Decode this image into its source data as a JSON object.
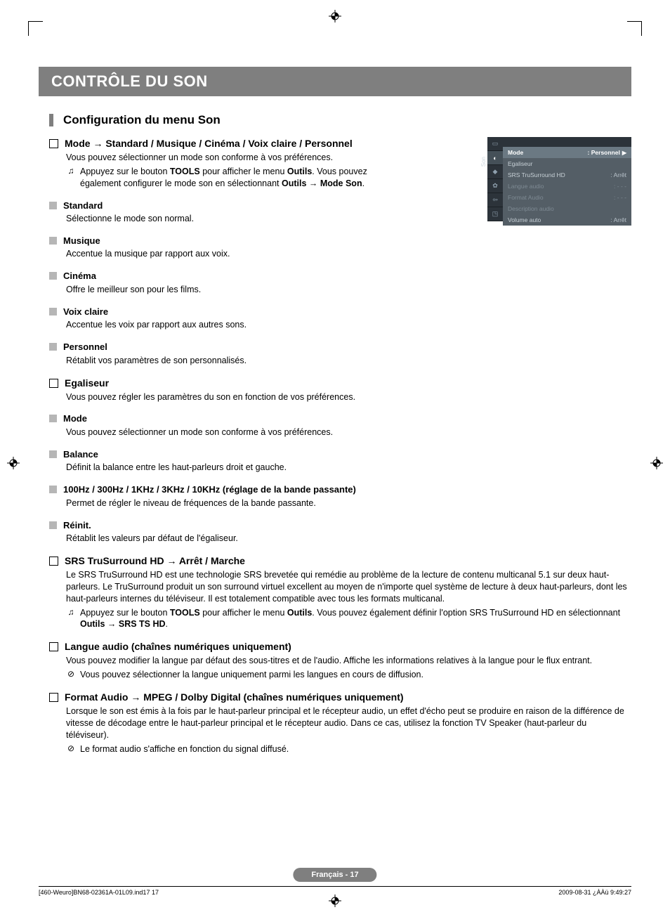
{
  "header": {
    "title": "CONTRÔLE DU SON"
  },
  "section": {
    "title": "Configuration du menu Son"
  },
  "mode_block": {
    "heading": "Mode → Standard / Musique / Cinéma / Voix claire / Personnel",
    "lead": "Vous pouvez sélectionner un mode son conforme à vos préférences.",
    "tip_a": "Appuyez sur le bouton ",
    "tip_tools": "TOOLS",
    "tip_b": " pour afficher le menu ",
    "tip_outils": "Outils",
    "tip_c": ". Vous pouvez également configurer le mode son en sélectionnant ",
    "tip_path": "Outils → Mode Son",
    "tip_d": "."
  },
  "mode_items": [
    {
      "name": "Standard",
      "desc": "Sélectionne le mode son normal."
    },
    {
      "name": "Musique",
      "desc": "Accentue la musique par rapport aux voix."
    },
    {
      "name": "Cinéma",
      "desc": "Offre le meilleur son pour les films."
    },
    {
      "name": "Voix claire",
      "desc": "Accentue les voix par rapport aux autres sons."
    },
    {
      "name": "Personnel",
      "desc": "Rétablit vos paramètres de son personnalisés."
    }
  ],
  "equalizer": {
    "heading": "Egaliseur",
    "lead": "Vous pouvez régler les paramètres du son en fonction de vos préférences."
  },
  "equalizer_items": [
    {
      "name": "Mode",
      "desc": "Vous pouvez sélectionner un mode son conforme à vos préférences."
    },
    {
      "name": "Balance",
      "desc": "Définit la balance entre les haut-parleurs droit et gauche."
    },
    {
      "name": "100Hz / 300Hz / 1KHz / 3KHz / 10KHz (réglage de la bande passante)",
      "desc": "Permet de régler le niveau de fréquences de la bande passante."
    },
    {
      "name": "Réinit.",
      "desc": "Rétablit les valeurs par défaut de l'égaliseur."
    }
  ],
  "srs": {
    "heading": "SRS TruSurround HD → Arrêt / Marche",
    "lead": "Le SRS TruSurround HD est une technologie SRS brevetée qui remédie au problème de la lecture de contenu multicanal 5.1 sur deux haut-parleurs. Le TruSurround produit un son surround virtuel excellent au moyen de n'importe quel système de lecture à deux haut-parleurs, dont les haut-parleurs internes du téléviseur. Il est totalement compatible avec tous les formats multicanal.",
    "tip_a": "Appuyez sur le bouton ",
    "tip_tools": "TOOLS",
    "tip_b": " pour afficher le menu ",
    "tip_outils": "Outils",
    "tip_c": ". Vous pouvez également définir l'option SRS TruSurround HD en sélectionnant ",
    "tip_path": "Outils → SRS TS HD",
    "tip_d": "."
  },
  "langue": {
    "heading": "Langue audio (chaînes numériques uniquement)",
    "lead": "Vous pouvez modifier la langue par défaut des sous-titres et de l'audio. Affiche les informations relatives à la langue pour le flux entrant.",
    "note": "Vous pouvez sélectionner la langue uniquement parmi les langues en cours de diffusion."
  },
  "format": {
    "heading": "Format Audio → MPEG / Dolby Digital (chaînes numériques uniquement)",
    "lead": "Lorsque le son est émis à la fois par le haut-parleur principal et le récepteur audio, un effet d'écho peut se produire en raison de la différence de vitesse de décodage entre le haut-parleur principal et le récepteur audio. Dans ce cas, utilisez la fonction TV Speaker (haut-parleur du téléviseur).",
    "note": "Le format audio s'affiche en fonction du signal diffusé."
  },
  "osd": {
    "cat": "Son",
    "rows": [
      {
        "k": "Mode",
        "v": ": Personnel",
        "sel": true
      },
      {
        "k": "Egaliseur",
        "v": ""
      },
      {
        "k": "SRS TruSurround HD",
        "v": ": Arrêt"
      },
      {
        "k": "Langue audio",
        "v": ": - - -",
        "dim": true
      },
      {
        "k": "Format Audio",
        "v": ": - - -",
        "dim": true
      },
      {
        "k": "Description audio",
        "v": "",
        "dim": true
      },
      {
        "k": "Volume auto",
        "v": ": Arrêt"
      }
    ]
  },
  "footer": {
    "pill": "Français - 17"
  },
  "footline": {
    "left": "[460-Weuro]BN68-02361A-01L09.ind17   17",
    "right": "2009-08-31   ¿ÀÀü 9:49:27"
  }
}
